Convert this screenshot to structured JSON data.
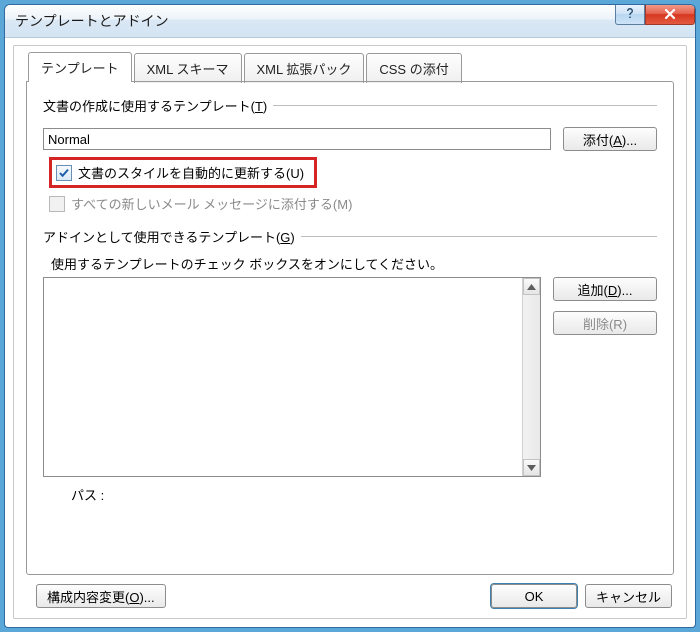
{
  "titlebar": {
    "title": "テンプレートとアドイン"
  },
  "tabs": [
    {
      "label": "テンプレート",
      "active": true
    },
    {
      "label": "XML スキーマ",
      "active": false
    },
    {
      "label": "XML 拡張パック",
      "active": false
    },
    {
      "label": "CSS の添付",
      "active": false
    }
  ],
  "templateSection": {
    "legend_pre": "文書の作成に使用するテンプレート(",
    "legend_key": "T",
    "legend_post": ")",
    "value": "Normal",
    "attach_pre": "添付(",
    "attach_key": "A",
    "attach_post": ")...",
    "chk_auto_pre": "文書のスタイルを自動的に更新する(",
    "chk_auto_key": "U",
    "chk_auto_post": ")",
    "chk_mail_pre": "すべての新しいメール メッセージに添付する(",
    "chk_mail_key": "M",
    "chk_mail_post": ")"
  },
  "addinSection": {
    "legend_pre": "アドインとして使用できるテンプレート(",
    "legend_key": "G",
    "legend_post": ")",
    "hint": "使用するテンプレートのチェック ボックスをオンにしてください。",
    "add_pre": "追加(",
    "add_key": "D",
    "add_post": ")...",
    "remove_pre": "削除(",
    "remove_key": "R",
    "remove_post": ")",
    "path_label": "パス :"
  },
  "footer": {
    "organizer_pre": "構成内容変更(",
    "organizer_key": "O",
    "organizer_post": ")...",
    "ok": "OK",
    "cancel": "キャンセル"
  }
}
